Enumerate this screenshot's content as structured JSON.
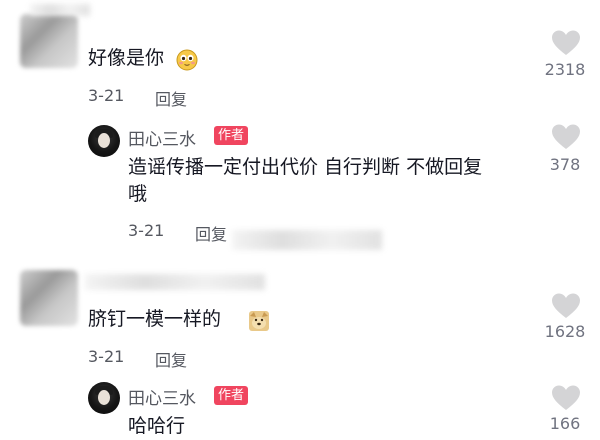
{
  "comments": [
    {
      "text": "好像是你",
      "emoji": "shy-face-emoji",
      "date": "3-21",
      "reply_label": "回复",
      "likes": "2318"
    },
    {
      "text": "脐钉一模一样的",
      "emoji": "doge-emoji",
      "date": "3-21",
      "reply_label": "回复",
      "likes": "1628"
    }
  ],
  "replies": [
    {
      "author": "田心三水",
      "badge": "作者",
      "text_line1": "造谣传播一定付出代价 自行判断 不做回复",
      "text_line2": "哦",
      "date": "3-21",
      "reply_label": "回复",
      "likes": "378"
    },
    {
      "author": "田心三水",
      "badge": "作者",
      "text_line1": "哈哈行",
      "likes": "166"
    }
  ],
  "colors": {
    "like_heart": "#d4d4d6",
    "badge": "#f0455f",
    "meta_text": "#555860"
  }
}
